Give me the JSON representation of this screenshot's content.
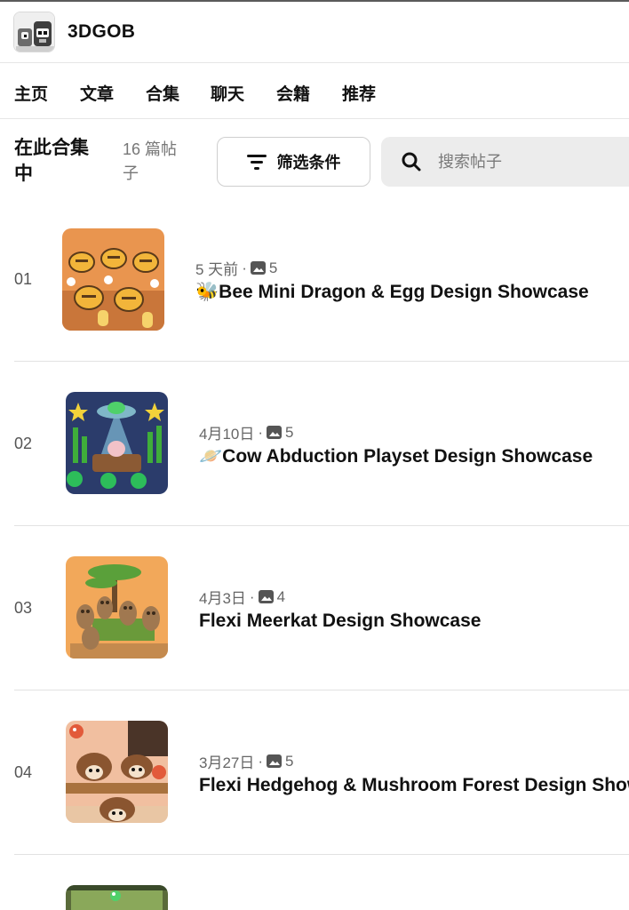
{
  "brand": {
    "name": "3DGOB"
  },
  "nav": [
    "主页",
    "文章",
    "合集",
    "聊天",
    "会籍",
    "推荐"
  ],
  "toolbar": {
    "context": "在此合集中",
    "count": "16 篇帖子",
    "filter_label": "筛选条件",
    "search_placeholder": "搜索帖子"
  },
  "posts": [
    {
      "num": "01",
      "date": "5 天前",
      "sep": "·",
      "images": "5",
      "title": "🐝Bee Mini Dragon & Egg Design Showcase"
    },
    {
      "num": "02",
      "date": "4月10日",
      "sep": "·",
      "images": "5",
      "title": "🪐Cow Abduction Playset Design Showcase"
    },
    {
      "num": "03",
      "date": "4月3日",
      "sep": "·",
      "images": "4",
      "title": "Flexi Meerkat Design Showcase"
    },
    {
      "num": "04",
      "date": "3月27日",
      "sep": "·",
      "images": "5",
      "title": "Flexi Hedgehog & Mushroom Forest Design Showcase"
    }
  ],
  "colors": {
    "search_bg": "#ececec",
    "divider": "#e2e2e2",
    "muted_text": "#666666"
  }
}
